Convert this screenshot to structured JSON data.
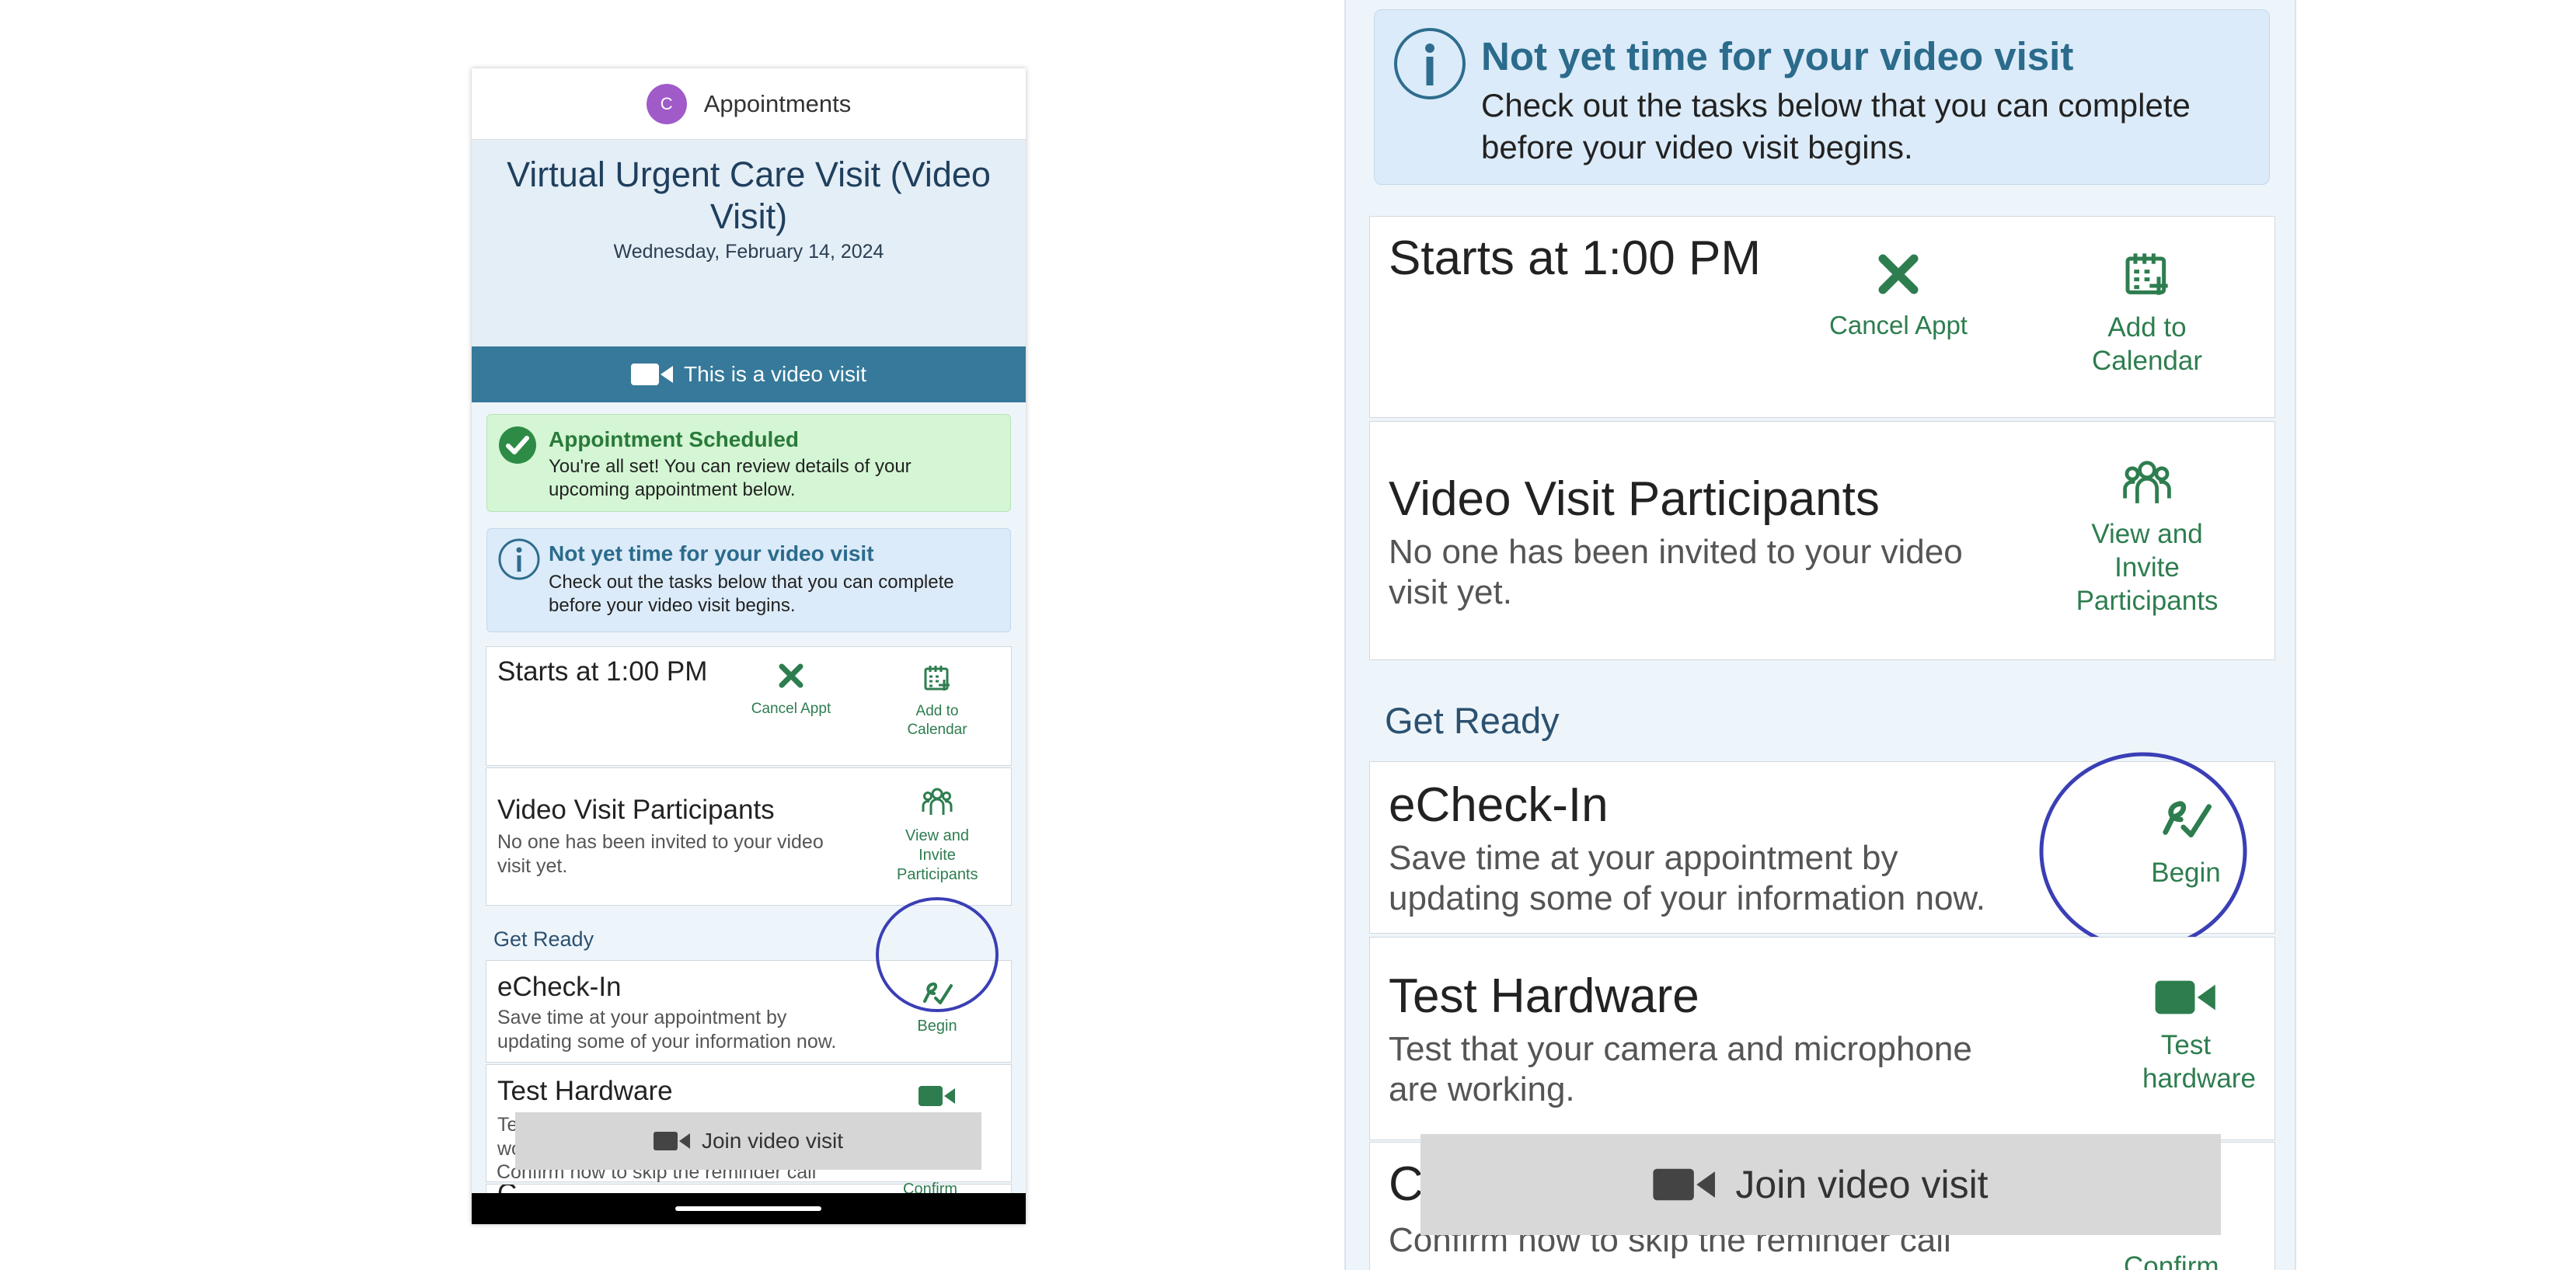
{
  "header": {
    "avatar_initial": "C",
    "title": "Appointments"
  },
  "visit": {
    "title": "Virtual Urgent Care Visit (Video Visit)",
    "date": "Wednesday, February 14, 2024"
  },
  "video_banner": {
    "label": "This is a video visit"
  },
  "alert_scheduled": {
    "title": "Appointment Scheduled",
    "body": "You're all set! You can review details of your upcoming appointment below."
  },
  "alert_not_yet": {
    "title": "Not yet time for your video visit",
    "body": "Check out the tasks below that you can complete before your video visit begins."
  },
  "start_card": {
    "time": "Starts at 1:00 PM",
    "cancel_label": "Cancel Appt",
    "calendar_label": "Add to Calendar"
  },
  "participants_card": {
    "title": "Video Visit Participants",
    "body": "No one has been invited to your video visit yet.",
    "action_label": "View and Invite Participants"
  },
  "get_ready": {
    "title": "Get Ready"
  },
  "echeckin": {
    "title": "eCheck-In",
    "body": "Save time at your appointment by updating some of your information now.",
    "action_label": "Begin"
  },
  "test_hardware": {
    "title": "Test Hardware",
    "body": "Test that your camera and microphone are working.",
    "action_label": "Test hardware"
  },
  "confirm": {
    "title_initial": "C",
    "body_visible": "Confirm now to skip the reminder call",
    "action_label": "Confirm"
  },
  "join": {
    "label": "Join video visit"
  },
  "colors": {
    "accent_green": "#2e7d4f",
    "banner_blue": "#36799a",
    "highlight_circle": "#3a3fb5",
    "avatar": "#a05bc9"
  }
}
